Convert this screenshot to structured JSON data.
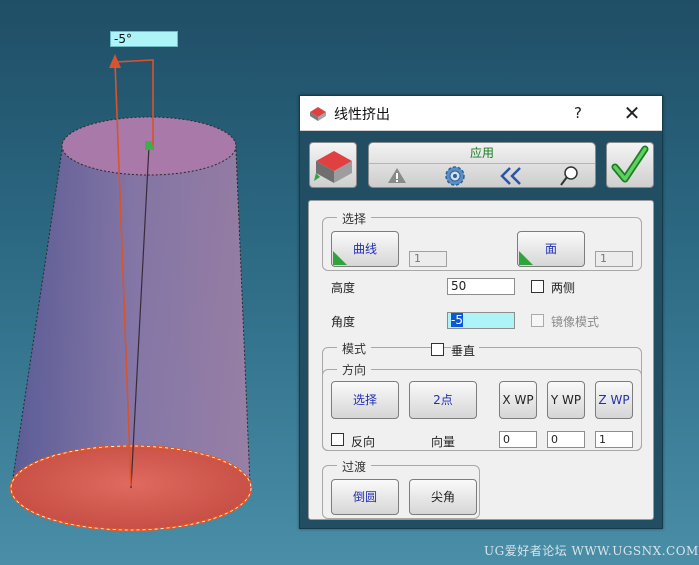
{
  "viewport": {
    "angle_label": "-5°"
  },
  "dialog": {
    "title": "线性挤出",
    "help": "?",
    "close": "✕",
    "apply_label": "应用",
    "toolbar_icons": [
      "warning-icon",
      "gear-icon",
      "collapse-icon",
      "magnifier-icon"
    ],
    "select_group": {
      "label": "选择",
      "curve_button": "曲线",
      "curve_count": "1",
      "face_button": "面",
      "face_count": "1"
    },
    "height": {
      "label": "高度",
      "value": "50",
      "both_sides_label": "两侧"
    },
    "angle": {
      "label": "角度",
      "value": "-5",
      "mirror_label": "镜像模式"
    },
    "mode_group": {
      "label": "模式",
      "perpendicular_label": "垂直"
    },
    "direction_group": {
      "label": "方向",
      "select_button": "选择",
      "two_point_button": "2点",
      "xwp_button": "X WP",
      "ywp_button": "Y WP",
      "zwp_button": "Z WP",
      "reverse_label": "反向",
      "vector_label": "向量",
      "vector": [
        "0",
        "0",
        "1"
      ]
    },
    "transition_group": {
      "label": "过渡",
      "fillet_button": "倒圆",
      "sharp_button": "尖角"
    }
  },
  "watermark": "UG爱好者论坛 WWW.UGSNX.COM",
  "colors": {
    "accent_green": "#2fa43b",
    "selection_blue": "#0a5ad8",
    "input_highlight": "#aef3f7",
    "shape_fill": "#7a6ea8",
    "base_fill": "#d9574f",
    "arrow": "#d9532c"
  }
}
